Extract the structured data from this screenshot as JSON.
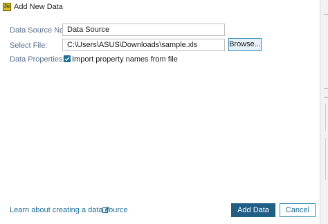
{
  "window": {
    "title": "Add New Data",
    "app_icon_glyph": "Ju"
  },
  "form": {
    "data_source_name": {
      "label": "Data Source Name:",
      "value": "Data Source"
    },
    "select_file": {
      "label": "Select File:",
      "value": "C:\\Users\\ASUS\\Downloads\\sample.xls",
      "browse_label": "Browse..."
    },
    "data_properties": {
      "label": "Data Properties:",
      "checkbox_label": "Import property names from file",
      "checked": true
    }
  },
  "footer": {
    "learn_link": "Learn about creating a data source",
    "primary_label": "Add Data",
    "cancel_label": "Cancel"
  },
  "colors": {
    "accent": "#1f6f98",
    "primary_button": "#1f5e85",
    "label_text": "#5a6f8c"
  },
  "icons": {
    "app": "app-logo-icon",
    "checkbox": "checkmark-icon",
    "external_link": "external-link-icon"
  }
}
